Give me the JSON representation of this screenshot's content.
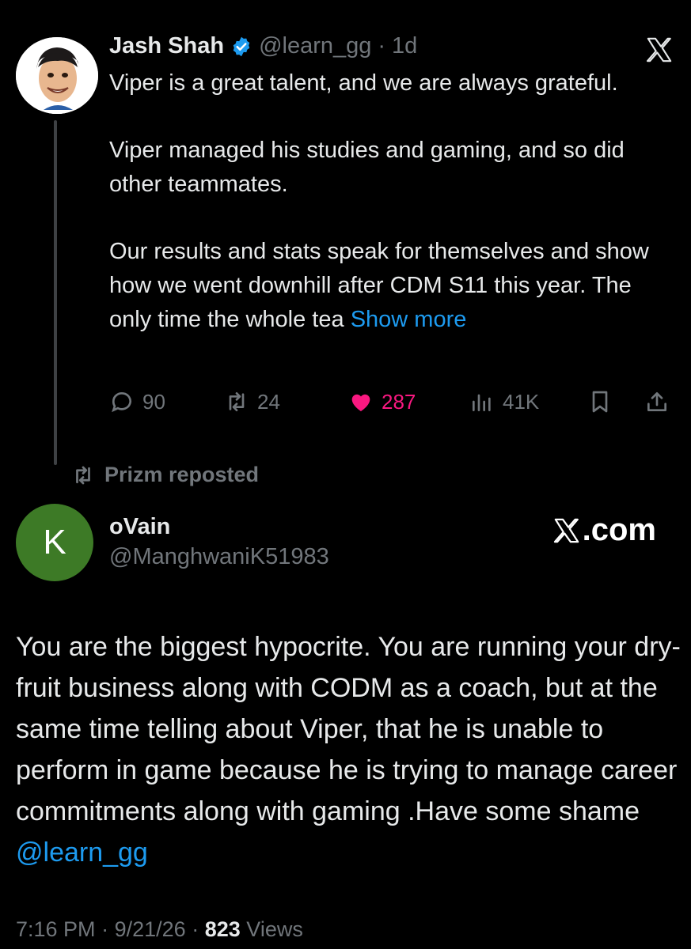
{
  "quoted_tweet": {
    "author_name": "Jash Shah",
    "handle": "@learn_gg",
    "separator": "·",
    "time_ago": "1d",
    "paragraphs": [
      "Viper is a great talent, and we are always grateful.",
      "Viper managed his studies and gaming, and so did other teammates.",
      "Our results and stats speak for themselves and show how we went downhill after CDM S11 this year. The only time the whole tea"
    ],
    "show_more_label": "Show more",
    "stats": {
      "replies": "90",
      "reposts": "24",
      "likes": "287",
      "views": "41K"
    },
    "icons": [
      "verified-badge-icon",
      "x-logo-icon",
      "reply-icon",
      "repost-icon",
      "heart-icon",
      "views-icon",
      "bookmark-icon",
      "share-icon"
    ]
  },
  "repost_line": {
    "text": "Prizm reposted"
  },
  "main_tweet": {
    "avatar_letter": "K",
    "author_name": "oVain",
    "handle": "@ManghwaniK51983",
    "brand_label": ".com",
    "text": "You are the biggest hypocrite. You are running your dry-fruit business along with  CODM as a coach, but at the same time  telling about  Viper, that he is unable to perform  in game because he is trying to manage career commitments along with gaming .Have some shame ",
    "mention": "@learn_gg",
    "timestamp": "7:16 PM",
    "date": "9/21/26",
    "sep": "·",
    "views_count": "823",
    "views_label": "Views"
  },
  "colors": {
    "background": "#000000",
    "text": "#e7e9ea",
    "muted": "#71767b",
    "link": "#1d9bf0",
    "like": "#f91880",
    "avatar_green": "#3d7a26"
  }
}
